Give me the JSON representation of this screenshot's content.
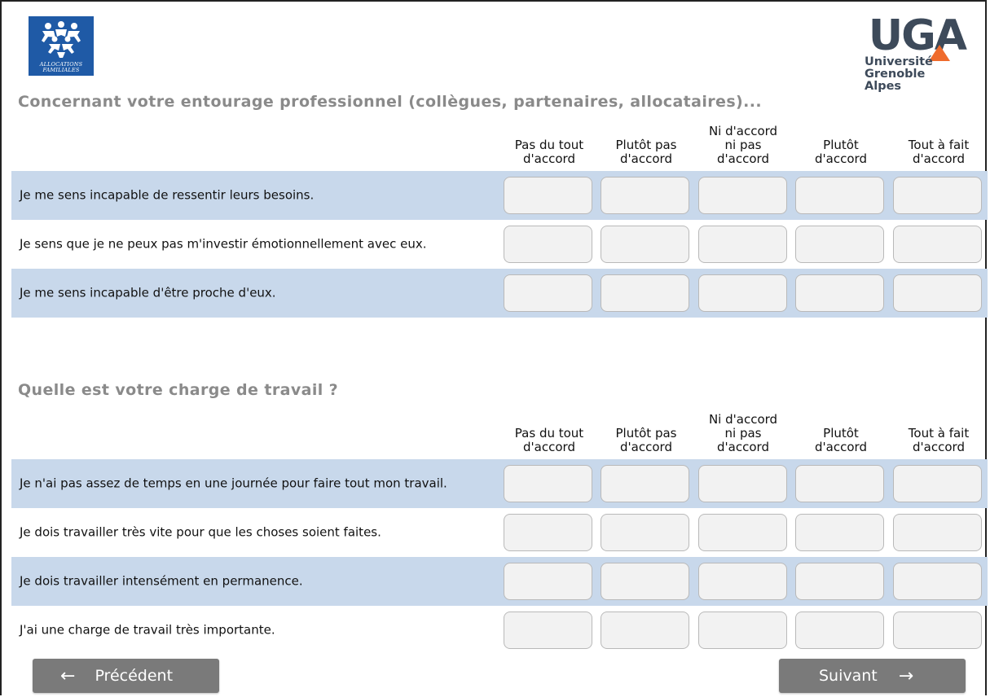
{
  "logos": {
    "caf": {
      "line1": "ALLOCATIONS",
      "line2": "FAMILIALES",
      "color": "#1f5aa6"
    },
    "uga": {
      "letters": "UGA",
      "line1": "Université",
      "line2": "Grenoble Alpes",
      "accent": "#ef6b2c"
    }
  },
  "scale": [
    "Pas du tout d'accord",
    "Plutôt pas d'accord",
    "Ni d'accord ni pas d'accord",
    "Plutôt d'accord",
    "Tout à fait d'accord"
  ],
  "sections": [
    {
      "title": "Concernant votre entourage professionnel (collègues, partenaires, allocataires)...",
      "headers": [
        "Pas du tout\nd'accord",
        "Plutôt pas\nd'accord",
        "Ni d'accord\nni pas\nd'accord",
        "Plutôt\nd'accord",
        "Tout à fait\nd'accord"
      ],
      "items": [
        "Je me sens incapable de ressentir leurs besoins.",
        "Je sens que je ne peux pas m'investir émotionnellement avec eux.",
        "Je me sens incapable d'être proche d'eux."
      ]
    },
    {
      "title": "Quelle est votre charge de travail ?",
      "headers": [
        "Pas du tout\nd'accord",
        "Plutôt pas\nd'accord",
        "Ni d'accord\nni pas\nd'accord",
        "Plutôt\nd'accord",
        "Tout à fait\nd'accord"
      ],
      "items": [
        "Je n'ai pas assez de temps en une journée pour faire tout mon travail.",
        "Je dois travailler très vite pour que les choses soient faites.",
        "Je dois travailler intensément en permanence.",
        "J'ai une charge de travail très importante."
      ]
    }
  ],
  "nav": {
    "prev_label": "Précédent",
    "next_label": "Suivant",
    "prev_arrow": "←",
    "next_arrow": "→"
  },
  "colors": {
    "row_shade": "#c8d8eb",
    "title_gray": "#8a8a8a",
    "button_gray": "#7a7a7a",
    "cell_bg": "#f2f2f2"
  }
}
